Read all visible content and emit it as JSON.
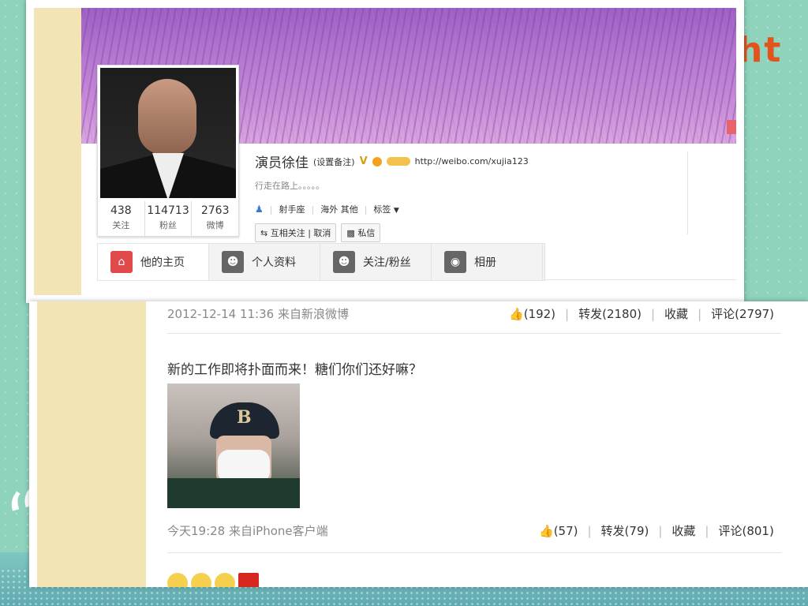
{
  "decor": {
    "corner_text": "ht",
    "quote_mark": "“"
  },
  "profile": {
    "name": "演员徐佳",
    "remark": "(设置备注)",
    "v_badge": "V",
    "url": "http://weibo.com/xujia123",
    "motto": "行走在路上。。。。。",
    "tags": [
      "射手座",
      "海外 其他",
      "标签"
    ],
    "stats": [
      {
        "num": "438",
        "label": "关注"
      },
      {
        "num": "114713",
        "label": "粉丝"
      },
      {
        "num": "2763",
        "label": "微博"
      }
    ],
    "buttons": {
      "mutual_follow": "互相关注",
      "cancel": "取消",
      "message": "私信"
    }
  },
  "tabs": [
    {
      "label": "他的主页",
      "icon": "home-icon"
    },
    {
      "label": "个人资料",
      "icon": "person-icon"
    },
    {
      "label": "关注/粉丝",
      "icon": "people-icon"
    },
    {
      "label": "相册",
      "icon": "camera-icon"
    }
  ],
  "posts": [
    {
      "time": "2012-12-14 11:36",
      "source": "来自新浪微博",
      "likes": "(192)",
      "forward": "转发(2180)",
      "favorite": "收藏",
      "comment": "评论(2797)"
    },
    {
      "text": "新的工作即将扑面而来！糖们你们还好嘛？",
      "time": "今天19:28",
      "source": "来自iPhone客户端",
      "likes": "(57)",
      "forward": "转发(79)",
      "favorite": "收藏",
      "comment": "评论(801)"
    }
  ],
  "colors": {
    "accent": "#e14a4a",
    "link_blue": "#3a7ccf",
    "side_panel": "#f2e4b5"
  }
}
